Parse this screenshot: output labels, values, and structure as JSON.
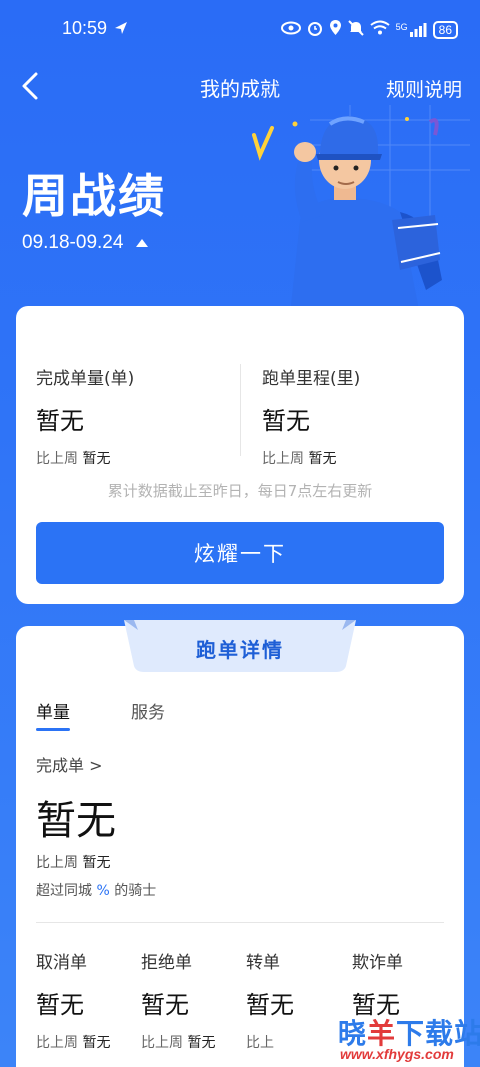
{
  "status_bar": {
    "time": "10:59",
    "network": "5G",
    "battery": "86",
    "icons": [
      "navigation-arrow-icon",
      "eye-icon",
      "alarm-icon",
      "location-icon",
      "mute-icon",
      "wifi-icon",
      "signal-icon",
      "battery-icon"
    ]
  },
  "header": {
    "title": "我的成就",
    "rules_label": "规则说明",
    "back_icon": "chevron-left-icon"
  },
  "hero": {
    "title": "周战绩",
    "date_range": "09.18-09.24",
    "toggle_icon": "triangle-up-icon"
  },
  "summary_card": {
    "orders_label": "完成单量(单)",
    "orders_value": "暂无",
    "orders_compare_prefix": "比上周",
    "orders_compare_value": "暂无",
    "distance_label": "跑单里程(里)",
    "distance_value": "暂无",
    "distance_compare_prefix": "比上周",
    "distance_compare_value": "暂无",
    "note": "累计数据截止至昨日，每日7点左右更新",
    "button_label": "炫耀一下"
  },
  "detail_card": {
    "title": "跑单详情",
    "tabs": [
      {
        "label": "单量",
        "active": true
      },
      {
        "label": "服务",
        "active": false
      }
    ],
    "completed_link": "完成单 >",
    "completed_value": "暂无",
    "compare_prefix": "比上周",
    "compare_value": "暂无",
    "exceed_prefix": "超过同城",
    "exceed_pct": "%",
    "exceed_suffix": "的骑士",
    "metrics": [
      {
        "label": "取消单",
        "value": "暂无",
        "compare_prefix": "比上周",
        "compare_value": "暂无"
      },
      {
        "label": "拒绝单",
        "value": "暂无",
        "compare_prefix": "比上周",
        "compare_value": "暂无"
      },
      {
        "label": "转单",
        "value": "暂无",
        "compare_prefix": "比上",
        "compare_value": ""
      },
      {
        "label": "欺诈单",
        "value": "暂无",
        "compare_prefix": "",
        "compare_value": ""
      }
    ]
  },
  "watermark": {
    "title_chars": [
      "晓",
      "羊",
      "下",
      "载",
      "站"
    ],
    "url": "www.xfhygs.com"
  },
  "colors": {
    "primary": "#2b73f5",
    "background": "#2f74f7",
    "card": "#ffffff",
    "watermark_red": "#e23b3b"
  }
}
